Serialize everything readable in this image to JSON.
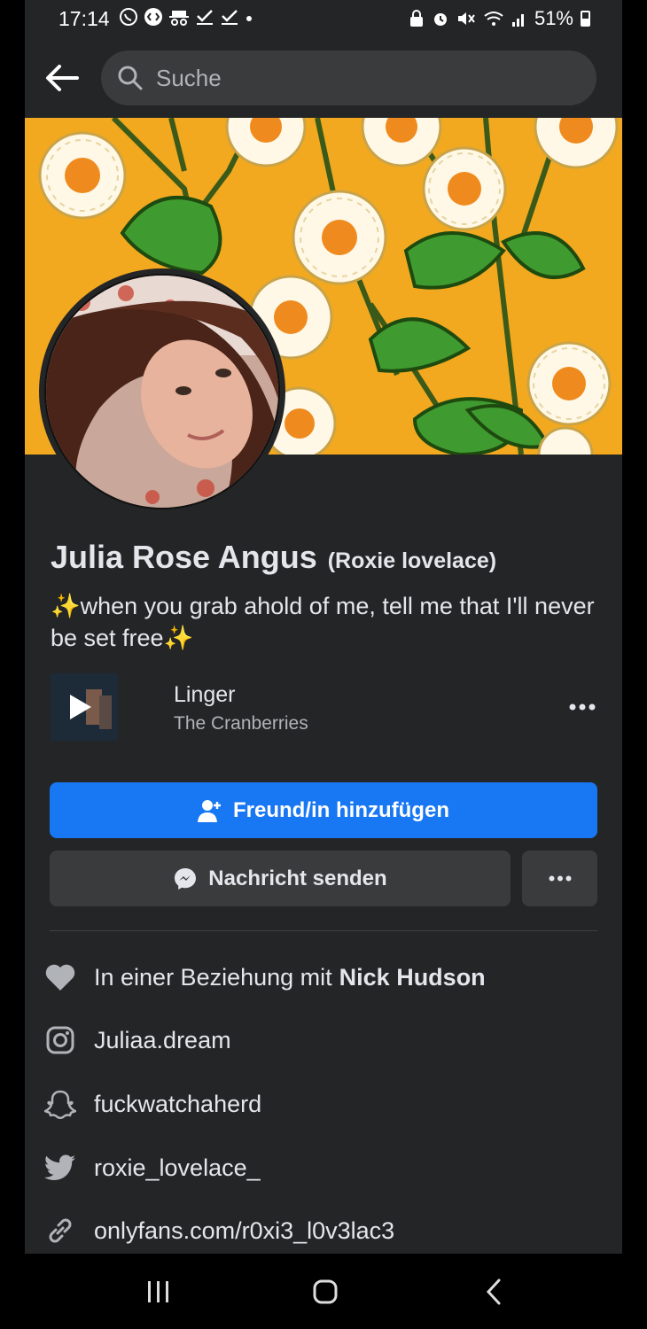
{
  "status_bar": {
    "time": "17:14",
    "battery": "51%"
  },
  "search": {
    "placeholder": "Suche"
  },
  "profile": {
    "name": "Julia Rose Angus",
    "alternate_name": "(Roxie lovelace)",
    "bio": "✨when you grab ahold of me, tell me that I'll never be set free✨"
  },
  "music": {
    "title": "Linger",
    "artist": "The Cranberries"
  },
  "actions": {
    "add_friend": "Freund/in hinzufügen",
    "message": "Nachricht senden"
  },
  "details": {
    "relationship_prefix": "In einer Beziehung mit",
    "relationship_partner": "Nick Hudson",
    "instagram": "Juliaa.dream",
    "snapchat": "fuckwatchaherd",
    "twitter": "roxie_lovelace_",
    "website": "onlyfans.com/r0xi3_l0v3lac3"
  },
  "colors": {
    "background": "#242526",
    "primary_button": "#1877f2",
    "secondary_button": "#3a3b3c",
    "cover_yellow": "#f2a91f"
  },
  "icons": {
    "back": "arrow-left-icon",
    "search": "search-icon",
    "add_friend": "person-plus-icon",
    "messenger": "messenger-icon",
    "heart": "heart-icon",
    "instagram": "instagram-icon",
    "snapchat": "snapchat-icon",
    "twitter": "twitter-icon",
    "link": "link-icon"
  }
}
